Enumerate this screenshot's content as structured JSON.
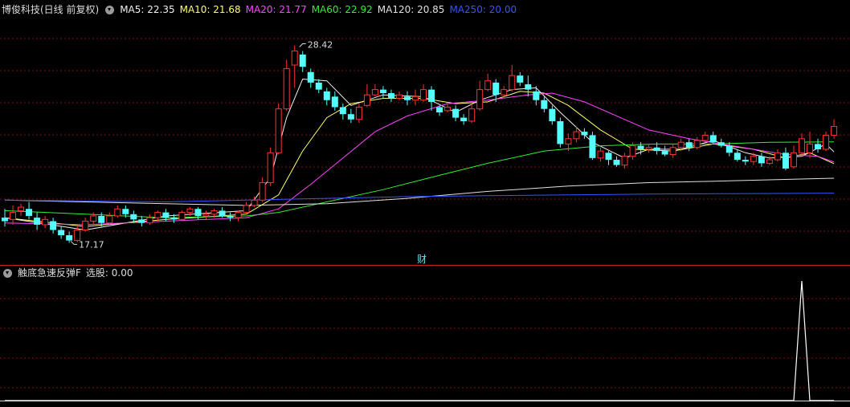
{
  "main_legend": {
    "title": "博俊科技(日线 前复权)",
    "items": [
      {
        "key": "MA5",
        "value": "22.35",
        "color": "#f0f0f0"
      },
      {
        "key": "MA10",
        "value": "21.68",
        "color": "#ffff66"
      },
      {
        "key": "MA20",
        "value": "21.77",
        "color": "#ff44ff"
      },
      {
        "key": "MA60",
        "value": "22.92",
        "color": "#33ee33"
      },
      {
        "key": "MA120",
        "value": "20.85",
        "color": "#e0e0e0"
      },
      {
        "key": "MA250",
        "value": "20.00",
        "color": "#3355ff"
      }
    ]
  },
  "sub_legend": {
    "title": "触底急速反弹F",
    "key": "选股",
    "value": "0.00"
  },
  "markers": {
    "high_label": "28.42",
    "low_label": "17.17",
    "finance_mark": "财"
  },
  "colors": {
    "up": "#ff3232",
    "down": "#54ffff",
    "grid": "#8a1010",
    "axis": "#c02020",
    "signal": "#ffffff"
  },
  "chart_data": [
    {
      "type": "candlestick",
      "title": "博俊科技(日线 前复权)",
      "ylim": [
        16.0,
        30.0
      ],
      "candles": [
        [
          18.6,
          18.4,
          19.1,
          18.1
        ],
        [
          18.5,
          18.9,
          19.3,
          18.2
        ],
        [
          19.0,
          19.2,
          19.4,
          18.7
        ],
        [
          19.1,
          18.7,
          19.5,
          18.5
        ],
        [
          18.6,
          18.2,
          18.9,
          17.9
        ],
        [
          18.2,
          18.5,
          18.7,
          18.0
        ],
        [
          18.4,
          17.9,
          18.6,
          17.7
        ],
        [
          17.9,
          17.6,
          18.1,
          17.4
        ],
        [
          17.6,
          17.3,
          17.8,
          17.17
        ],
        [
          17.3,
          17.9,
          18.1,
          17.2
        ],
        [
          17.9,
          18.4,
          18.6,
          17.8
        ],
        [
          18.4,
          18.7,
          18.9,
          18.2
        ],
        [
          18.7,
          18.3,
          18.9,
          18.1
        ],
        [
          18.3,
          18.7,
          18.9,
          18.2
        ],
        [
          18.7,
          19.1,
          19.3,
          18.6
        ],
        [
          19.1,
          18.8,
          19.3,
          18.6
        ],
        [
          18.8,
          18.5,
          19.0,
          18.3
        ],
        [
          18.5,
          18.3,
          18.7,
          18.1
        ],
        [
          18.3,
          18.6,
          18.8,
          18.2
        ],
        [
          18.6,
          18.9,
          19.0,
          18.4
        ],
        [
          18.9,
          18.6,
          19.1,
          18.4
        ],
        [
          18.6,
          18.5,
          18.8,
          18.3
        ],
        [
          18.5,
          18.9,
          19.0,
          18.4
        ],
        [
          18.9,
          19.1,
          19.2,
          18.7
        ],
        [
          19.1,
          18.7,
          19.2,
          18.5
        ],
        [
          18.7,
          18.8,
          19.0,
          18.5
        ],
        [
          18.8,
          19.0,
          19.1,
          18.6
        ],
        [
          19.0,
          18.7,
          19.2,
          18.6
        ],
        [
          18.7,
          18.6,
          18.9,
          18.4
        ],
        [
          18.6,
          18.9,
          19.0,
          18.4
        ],
        [
          18.9,
          19.3,
          19.5,
          18.8
        ],
        [
          19.3,
          19.6,
          19.8,
          19.2
        ],
        [
          19.6,
          20.6,
          20.9,
          19.5
        ],
        [
          20.6,
          22.3,
          22.6,
          20.4
        ],
        [
          22.3,
          24.8,
          25.1,
          22.2
        ],
        [
          24.8,
          27.1,
          27.6,
          24.7
        ],
        [
          27.3,
          28.1,
          28.42,
          26.0
        ],
        [
          27.9,
          27.2,
          28.1,
          26.9
        ],
        [
          26.9,
          26.3,
          27.1,
          26.0
        ],
        [
          26.3,
          25.9,
          26.5,
          25.7
        ],
        [
          25.8,
          25.3,
          26.0,
          25.0
        ],
        [
          25.5,
          24.9,
          25.8,
          24.7
        ],
        [
          24.9,
          24.5,
          25.1,
          24.2
        ],
        [
          24.5,
          24.2,
          24.8,
          24.0
        ],
        [
          24.2,
          24.9,
          25.1,
          24.0
        ],
        [
          25.0,
          25.6,
          26.2,
          24.9
        ],
        [
          25.6,
          25.9,
          26.2,
          25.5
        ],
        [
          25.9,
          25.7,
          26.1,
          25.4
        ],
        [
          25.7,
          25.4,
          25.9,
          25.2
        ],
        [
          25.4,
          25.6,
          25.8,
          25.3
        ],
        [
          25.5,
          25.3,
          25.8,
          25.0
        ],
        [
          25.3,
          25.5,
          25.9,
          25.0
        ],
        [
          25.3,
          25.9,
          26.2,
          25.2
        ],
        [
          25.9,
          25.2,
          26.1,
          24.7
        ],
        [
          24.9,
          24.6,
          25.0,
          24.4
        ],
        [
          24.7,
          24.9,
          25.1,
          24.6
        ],
        [
          24.8,
          24.3,
          25.0,
          24.1
        ],
        [
          24.3,
          24.1,
          24.5,
          23.9
        ],
        [
          24.1,
          24.8,
          25.1,
          24.0
        ],
        [
          24.8,
          25.9,
          26.4,
          24.7
        ],
        [
          25.9,
          26.4,
          26.8,
          25.8
        ],
        [
          26.3,
          25.6,
          26.5,
          25.2
        ],
        [
          25.6,
          25.9,
          26.1,
          25.4
        ],
        [
          25.9,
          26.7,
          27.3,
          25.8
        ],
        [
          26.7,
          26.3,
          26.9,
          26.1
        ],
        [
          26.2,
          25.9,
          26.7,
          25.5
        ],
        [
          25.8,
          25.3,
          26.1,
          25.0
        ],
        [
          25.3,
          24.8,
          25.5,
          24.6
        ],
        [
          24.8,
          24.1,
          25.0,
          23.9
        ],
        [
          24.1,
          22.8,
          24.3,
          22.6
        ],
        [
          22.8,
          23.1,
          23.4,
          22.4
        ],
        [
          23.1,
          23.5,
          23.8,
          22.9
        ],
        [
          23.5,
          23.3,
          23.7,
          23.1
        ],
        [
          23.3,
          22.0,
          23.5,
          21.9
        ],
        [
          22.0,
          22.4,
          22.6,
          21.8
        ],
        [
          22.3,
          21.9,
          22.4,
          21.6
        ],
        [
          21.9,
          21.6,
          22.1,
          21.5
        ],
        [
          21.6,
          22.1,
          22.3,
          21.4
        ],
        [
          22.1,
          22.7,
          22.9,
          21.9
        ],
        [
          22.7,
          22.5,
          22.9,
          22.2
        ],
        [
          22.5,
          22.6,
          22.8,
          22.3
        ],
        [
          22.6,
          22.4,
          22.9,
          22.2
        ],
        [
          22.4,
          22.2,
          22.7,
          22.1
        ],
        [
          22.2,
          22.6,
          22.8,
          22.0
        ],
        [
          22.6,
          22.9,
          23.1,
          22.4
        ],
        [
          22.9,
          22.6,
          23.1,
          22.4
        ],
        [
          22.6,
          23.0,
          23.2,
          22.5
        ],
        [
          23.0,
          23.3,
          23.5,
          22.9
        ],
        [
          23.3,
          22.9,
          23.5,
          22.8
        ],
        [
          22.9,
          22.7,
          23.1,
          22.6
        ],
        [
          22.7,
          22.3,
          22.9,
          22.1
        ],
        [
          22.3,
          21.9,
          22.5,
          21.8
        ],
        [
          21.9,
          21.8,
          22.1,
          21.6
        ],
        [
          21.8,
          22.1,
          22.3,
          21.6
        ],
        [
          22.1,
          21.7,
          22.3,
          21.5
        ],
        [
          21.7,
          21.9,
          22.1,
          21.6
        ],
        [
          21.9,
          22.3,
          22.5,
          21.8
        ],
        [
          22.3,
          21.4,
          22.6,
          21.3
        ],
        [
          21.5,
          22.3,
          22.7,
          21.4
        ],
        [
          22.3,
          23.1,
          23.4,
          22.1
        ],
        [
          22.3,
          22.8,
          23.5,
          22.0
        ],
        [
          22.8,
          22.5,
          23.1,
          22.3
        ],
        [
          22.5,
          23.3,
          23.5,
          22.4
        ],
        [
          23.3,
          23.8,
          24.2,
          23.1
        ]
      ],
      "ma_values": {
        "MA5": [
          [
            0,
            18.6
          ],
          [
            10,
            17.9
          ],
          [
            20,
            18.7
          ],
          [
            30,
            19.0
          ],
          [
            33,
            20.9
          ],
          [
            35,
            24.3
          ],
          [
            37,
            26.5
          ],
          [
            40,
            26.4
          ],
          [
            43,
            25.0
          ],
          [
            47,
            25.6
          ],
          [
            52,
            25.5
          ],
          [
            56,
            24.6
          ],
          [
            59,
            25.3
          ],
          [
            63,
            25.9
          ],
          [
            66,
            26.0
          ],
          [
            69,
            24.6
          ],
          [
            73,
            22.9
          ],
          [
            77,
            22.0
          ],
          [
            80,
            22.5
          ],
          [
            84,
            22.5
          ],
          [
            88,
            23.0
          ],
          [
            92,
            22.3
          ],
          [
            95,
            22.0
          ],
          [
            99,
            22.1
          ],
          [
            102,
            22.8
          ],
          [
            103,
            22.35
          ]
        ],
        "MA10": [
          [
            0,
            18.6
          ],
          [
            10,
            18.1
          ],
          [
            20,
            18.5
          ],
          [
            30,
            18.8
          ],
          [
            34,
            19.9
          ],
          [
            37,
            22.4
          ],
          [
            40,
            24.3
          ],
          [
            43,
            25.1
          ],
          [
            47,
            25.4
          ],
          [
            52,
            25.4
          ],
          [
            56,
            25.1
          ],
          [
            60,
            25.2
          ],
          [
            64,
            25.8
          ],
          [
            67,
            25.7
          ],
          [
            70,
            25.0
          ],
          [
            74,
            23.6
          ],
          [
            78,
            22.5
          ],
          [
            83,
            22.4
          ],
          [
            88,
            22.8
          ],
          [
            93,
            22.5
          ],
          [
            97,
            22.0
          ],
          [
            100,
            22.3
          ],
          [
            103,
            21.68
          ]
        ],
        "MA20": [
          [
            0,
            18.3
          ],
          [
            10,
            18.2
          ],
          [
            20,
            18.4
          ],
          [
            30,
            18.6
          ],
          [
            34,
            19.1
          ],
          [
            38,
            20.5
          ],
          [
            42,
            22.0
          ],
          [
            46,
            23.5
          ],
          [
            50,
            24.4
          ],
          [
            55,
            25.1
          ],
          [
            60,
            25.3
          ],
          [
            65,
            25.6
          ],
          [
            68,
            25.7
          ],
          [
            72,
            25.2
          ],
          [
            76,
            24.4
          ],
          [
            80,
            23.6
          ],
          [
            85,
            23.1
          ],
          [
            89,
            22.8
          ],
          [
            93,
            22.5
          ],
          [
            97,
            22.2
          ],
          [
            101,
            22.1
          ],
          [
            103,
            21.77
          ]
        ],
        "MA60": [
          [
            0,
            19.0
          ],
          [
            10,
            18.8
          ],
          [
            20,
            18.6
          ],
          [
            30,
            18.7
          ],
          [
            34,
            18.9
          ],
          [
            40,
            19.5
          ],
          [
            47,
            20.2
          ],
          [
            53,
            20.9
          ],
          [
            60,
            21.7
          ],
          [
            67,
            22.4
          ],
          [
            74,
            22.7
          ],
          [
            81,
            22.8
          ],
          [
            88,
            22.8
          ],
          [
            95,
            22.9
          ],
          [
            103,
            22.92
          ]
        ],
        "MA120": [
          [
            0,
            19.6
          ],
          [
            10,
            19.5
          ],
          [
            20,
            19.4
          ],
          [
            30,
            19.3
          ],
          [
            40,
            19.4
          ],
          [
            50,
            19.7
          ],
          [
            60,
            20.1
          ],
          [
            70,
            20.4
          ],
          [
            80,
            20.6
          ],
          [
            90,
            20.7
          ],
          [
            103,
            20.85
          ]
        ],
        "MA250": [
          [
            0,
            19.6
          ],
          [
            10,
            19.55
          ],
          [
            20,
            19.5
          ],
          [
            30,
            19.6
          ],
          [
            40,
            19.7
          ],
          [
            50,
            19.8
          ],
          [
            60,
            19.85
          ],
          [
            70,
            19.9
          ],
          [
            80,
            19.95
          ],
          [
            90,
            19.97
          ],
          [
            103,
            20.0
          ]
        ]
      },
      "high_mark": {
        "index": 36,
        "value": 28.42
      },
      "low_mark": {
        "index": 8,
        "value": 17.17
      }
    },
    {
      "type": "line",
      "title": "触底急速反弹F",
      "ylim": [
        0,
        1
      ],
      "signal": [
        [
          0,
          0
        ],
        [
          98,
          0
        ],
        [
          99,
          1
        ],
        [
          100,
          0
        ],
        [
          103,
          0
        ]
      ]
    }
  ]
}
